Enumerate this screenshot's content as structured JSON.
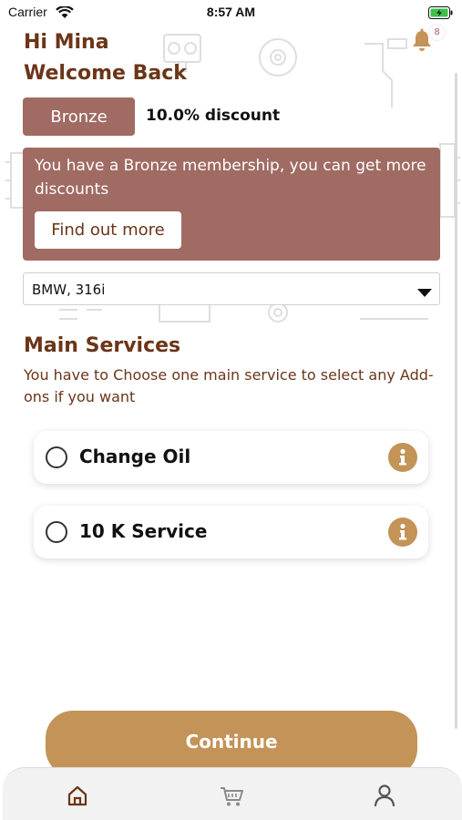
{
  "status_bar": {
    "carrier": "Carrier",
    "time": "8:57 AM"
  },
  "notifications": {
    "count": "8",
    "icon": "bell-icon"
  },
  "greeting": {
    "line1": "Hi Mina",
    "line2": "Welcome Back"
  },
  "membership": {
    "tier": "Bronze",
    "discount": "10.0% discount",
    "message": "You have a Bronze membership, you can get more discounts",
    "cta": "Find out more"
  },
  "vehicle": {
    "selected": "BMW, 316i"
  },
  "main_services": {
    "title": "Main Services",
    "description": "You have to Choose one main service to select any Add-ons if you want",
    "items": [
      {
        "label": "Change Oil"
      },
      {
        "label": "10 K Service"
      }
    ]
  },
  "continue_label": "Continue",
  "bottom_nav": {
    "items": [
      "home-icon",
      "cart-icon",
      "profile-icon"
    ]
  },
  "colors": {
    "brand_brown": "#6b3518",
    "membership_bg": "#a06b63",
    "accent_gold": "#c39357"
  }
}
